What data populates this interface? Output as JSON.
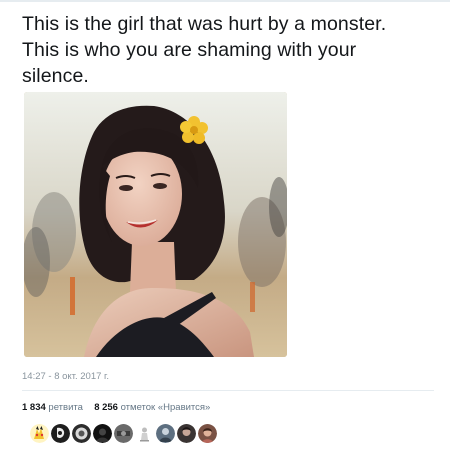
{
  "tweet": {
    "text_lines": [
      "This is the girl that was hurt by a monster.",
      "This is who you are shaming with your",
      "silence."
    ]
  },
  "meta": {
    "timestamp": "14:27 - 8 окт. 2017 г."
  },
  "stats": {
    "retweets_count": "1 834",
    "retweets_label": "ретвита",
    "likes_count": "8 256",
    "likes_label": "отметок «Нравится»"
  },
  "likers": {
    "count": 9,
    "avatars": [
      "avatar-yellow-pikachu",
      "avatar-black-white",
      "avatar-gray-circle",
      "avatar-dark-figure",
      "avatar-dark-gray",
      "avatar-white-figure",
      "avatar-blue-gray",
      "avatar-dark-portrait",
      "avatar-brown-portrait"
    ]
  },
  "colors": {
    "text": "#14171a",
    "muted": "#657786",
    "divider": "#e6ecf0"
  }
}
